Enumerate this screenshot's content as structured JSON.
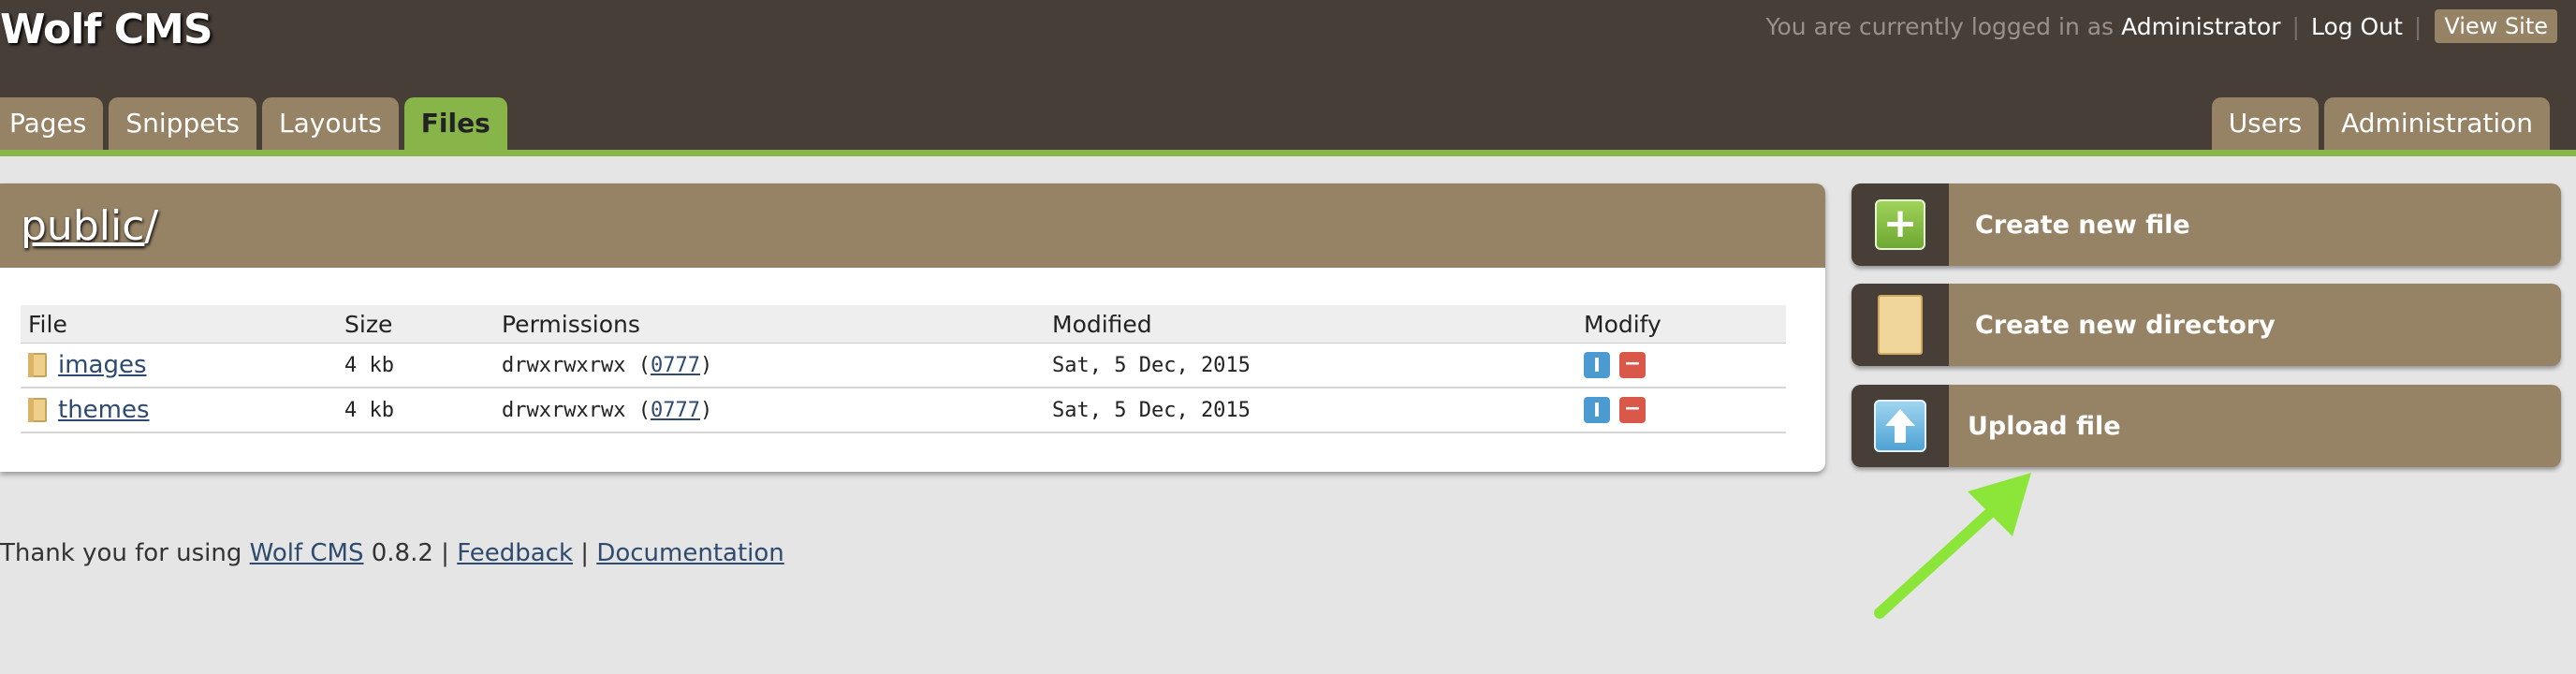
{
  "header": {
    "site_title": "Wolf CMS",
    "login_prefix": "You are currently logged in as",
    "username": "Administrator",
    "separator": "|",
    "logout": "Log Out",
    "view_site": "View Site"
  },
  "tabs_left": [
    "Pages",
    "Snippets",
    "Layouts",
    "Files"
  ],
  "active_tab": "Files",
  "tabs_right": [
    "Users",
    "Administration"
  ],
  "panel": {
    "path_link": "public",
    "path_suffix": "/"
  },
  "table": {
    "columns": [
      "File",
      "Size",
      "Permissions",
      "Modified",
      "Modify"
    ],
    "rows": [
      {
        "name": "images",
        "size": "4 kb",
        "perm": "drwxrwxrwx",
        "perm_code": "0777",
        "modified": "Sat, 5 Dec, 2015"
      },
      {
        "name": "themes",
        "size": "4 kb",
        "perm": "drwxrwxrwx",
        "perm_code": "0777",
        "modified": "Sat, 5 Dec, 2015"
      }
    ]
  },
  "footer": {
    "prefix": "Thank you for using",
    "product": "Wolf CMS",
    "version": "0.8.2",
    "sep": "|",
    "feedback": "Feedback",
    "documentation": "Documentation"
  },
  "sidebar": {
    "create_file": "Create new file",
    "create_directory": "Create new directory",
    "upload_file": "Upload file"
  },
  "icons": {
    "rename_glyph": "I",
    "delete_glyph": "−",
    "plus_glyph": "+"
  },
  "colors": {
    "header_bg": "#463e37",
    "tab_bg": "#968366",
    "active_tab": "#87b54a",
    "annotation_arrow": "#8ce63a"
  }
}
